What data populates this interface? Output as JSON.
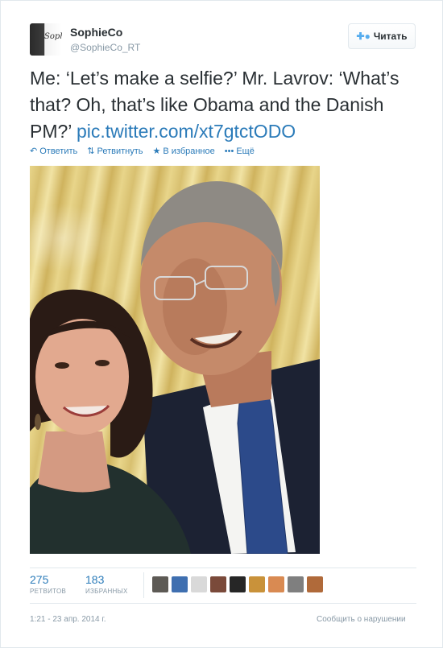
{
  "user": {
    "name": "SophieCo",
    "handle": "@SophieCo_RT",
    "avatar_signature": "Sophie"
  },
  "follow_button": {
    "icon": "add-user-icon",
    "label": "Читать"
  },
  "tweet": {
    "text": "Me: ‘Let’s make a selfie?’ Mr. Lavrov: ‘What’s that? Oh, that’s like Obama and the Danish PM?’ ",
    "link": "pic.twitter.com/xt7gtctODO"
  },
  "actions": {
    "reply": "Ответить",
    "retweet": "Ретвитнуть",
    "favorite": "В избранное",
    "more": "Ещё"
  },
  "stats": {
    "retweets_count": "275",
    "retweets_label": "РЕТВИТОВ",
    "favorites_count": "183",
    "favorites_label": "ИЗБРАННЫХ"
  },
  "footer": {
    "timestamp": "1:21 - 23 апр. 2014 г.",
    "report": "Сообщить о нарушении"
  },
  "colors": {
    "link": "#2b7bb9",
    "muted": "#8899a6",
    "border": "#e1e8ed"
  },
  "favoriters_avatar_colors": [
    "#5d5a55",
    "#3f6fb0",
    "#d9d9d9",
    "#7a4a3a",
    "#262626",
    "#c9923a",
    "#d98a52",
    "#7f7f7f",
    "#b06a3a"
  ]
}
